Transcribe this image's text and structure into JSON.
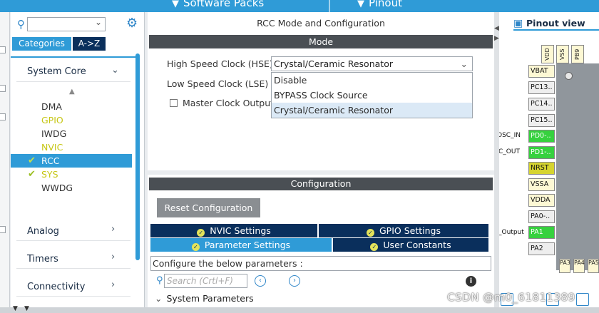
{
  "topbar": {
    "software_packs": "Software Packs",
    "pinout": "Pinout"
  },
  "left": {
    "tabs": [
      "Categories",
      "A->Z"
    ],
    "sections": {
      "system_core": "System Core",
      "analog": "Analog",
      "timers": "Timers",
      "connectivity": "Connectivity"
    },
    "items": [
      {
        "label": "DMA",
        "color": "normal",
        "checked": false,
        "selected": false
      },
      {
        "label": "GPIO",
        "color": "yellow",
        "checked": false,
        "selected": false
      },
      {
        "label": "IWDG",
        "color": "normal",
        "checked": false,
        "selected": false
      },
      {
        "label": "NVIC",
        "color": "yellow",
        "checked": false,
        "selected": false
      },
      {
        "label": "RCC",
        "color": "normal",
        "checked": true,
        "selected": true
      },
      {
        "label": "SYS",
        "color": "yellow",
        "checked": true,
        "selected": false
      },
      {
        "label": "WWDG",
        "color": "normal",
        "checked": false,
        "selected": false
      }
    ]
  },
  "mid": {
    "title": "RCC Mode and Configuration",
    "mode_header": "Mode",
    "hse_label": "High Speed Clock (HSE)",
    "hse_value": "Crystal/Ceramic Resonator",
    "lse_label": "Low Speed Clock (LSE)",
    "mco_label": "Master Clock Output",
    "dropdown_options": [
      "Disable",
      "BYPASS Clock Source",
      "Crystal/Ceramic Resonator"
    ],
    "config_header": "Configuration",
    "reset_button": "Reset Configuration",
    "tabs": {
      "nvic": "NVIC Settings",
      "gpio": "GPIO Settings",
      "param": "Parameter Settings",
      "user": "User Constants"
    },
    "configure_text": "Configure the below parameters :",
    "search_placeholder": "Search (Crtl+F)",
    "system_parameters": "System Parameters"
  },
  "right": {
    "tab": "Pinout view",
    "top_pins": [
      "VDD",
      "VSS",
      "PB9"
    ],
    "pins": [
      {
        "label": "VBAT",
        "color": "cream"
      },
      {
        "label": "PC13..",
        "color": "gray"
      },
      {
        "label": "PC14..",
        "color": "gray"
      },
      {
        "label": "PC15..",
        "color": "gray"
      },
      {
        "label": "PD0-..",
        "color": "green"
      },
      {
        "label": "PD1-..",
        "color": "green"
      },
      {
        "label": "NRST",
        "color": "yellow"
      },
      {
        "label": "VSSA",
        "color": "cream"
      },
      {
        "label": "VDDA",
        "color": "cream"
      },
      {
        "label": "PA0-..",
        "color": "gray"
      },
      {
        "label": "PA1",
        "color": "green"
      },
      {
        "label": "PA2",
        "color": "gray"
      }
    ],
    "signals": {
      "osc_in": "OSC_IN",
      "osc_out": "C_OUT",
      "output": "_Output"
    },
    "bottom_pins": [
      "PA3",
      "PA4",
      "PA5"
    ]
  },
  "watermark": "CSDN @m0_61811389"
}
